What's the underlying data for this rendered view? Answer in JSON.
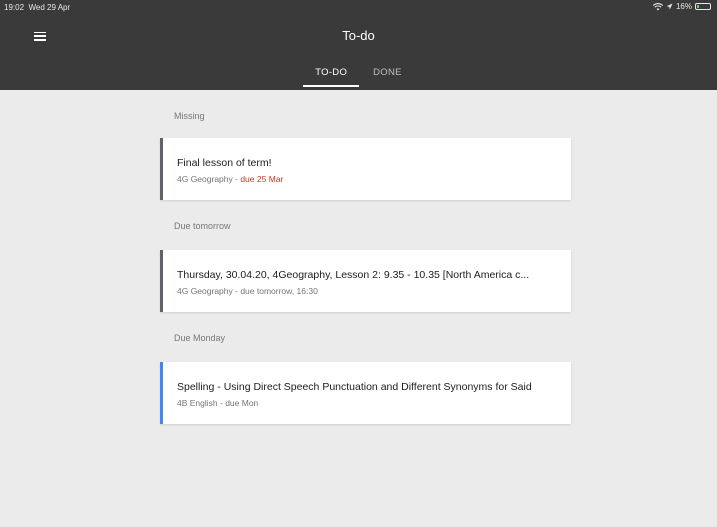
{
  "status_bar": {
    "time": "19:02",
    "date": "Wed 29 Apr",
    "battery": "16%",
    "battery_level": 0.16
  },
  "header": {
    "title": "To-do",
    "menu_icon": "hamburger-menu-icon"
  },
  "tabs": [
    {
      "label": "TO-DO",
      "active": true
    },
    {
      "label": "DONE",
      "active": false
    }
  ],
  "colors": {
    "header_bg": "#3a3a3a",
    "page_bg": "#ebebeb",
    "accent_grey": "#5f6368",
    "accent_blue": "#4285f4",
    "due_red": "#d93025"
  },
  "sections": [
    {
      "label": "Missing",
      "item": {
        "title": "Final lesson of term!",
        "class": "4G Geography",
        "separator": " - ",
        "due": "due 25 Mar",
        "due_overdue": true,
        "accent": "#5f6368"
      }
    },
    {
      "label": "Due tomorrow",
      "item": {
        "title": "Thursday, 30.04.20, 4Geography, Lesson 2: 9.35 - 10.35 [North America c...",
        "class": "4G Geography",
        "separator": " - ",
        "due": "due tomorrow, 16:30",
        "due_overdue": false,
        "accent": "#5f6368"
      }
    },
    {
      "label": "Due Monday",
      "item": {
        "title": "Spelling - Using Direct Speech Punctuation and Different Synonyms for Said",
        "class": "4B English",
        "separator": " - ",
        "due": "due Mon",
        "due_overdue": false,
        "accent": "#4285f4"
      }
    }
  ]
}
